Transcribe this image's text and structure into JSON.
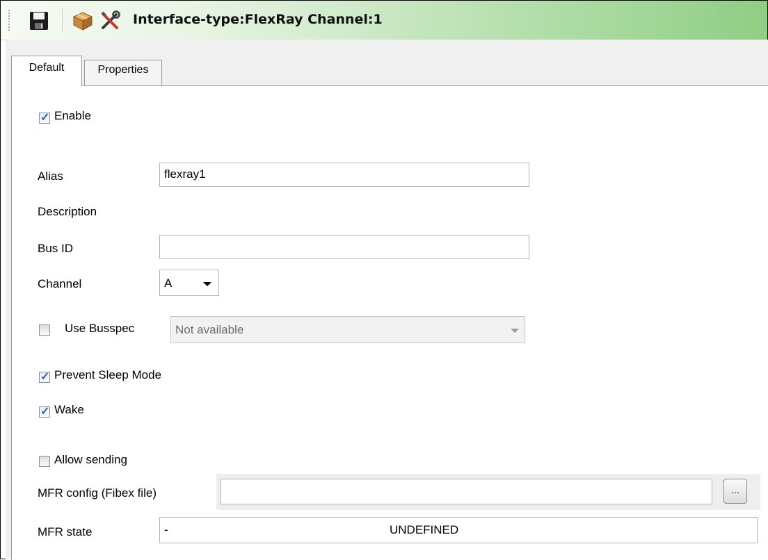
{
  "toolbar": {
    "title": "Interface-type:FlexRay Channel:1",
    "icons": [
      "save-icon",
      "package-icon",
      "tools-icon"
    ]
  },
  "tabs": [
    {
      "label": "Default",
      "selected": true
    },
    {
      "label": "Properties",
      "selected": false
    }
  ],
  "form": {
    "enable": {
      "label": "Enable",
      "checked": true
    },
    "alias": {
      "label": "Alias",
      "value": "flexray1"
    },
    "description": {
      "label": "Description"
    },
    "bus_id": {
      "label": "Bus ID",
      "value": ""
    },
    "channel": {
      "label": "Channel",
      "value": "A"
    },
    "use_busspec": {
      "label": "Use Busspec",
      "checked": false,
      "value": "Not available"
    },
    "prevent_sleep": {
      "label": "Prevent Sleep Mode",
      "checked": true
    },
    "wake": {
      "label": "Wake",
      "checked": true
    },
    "allow_sending": {
      "label": "Allow sending",
      "checked": false
    },
    "mfr_config": {
      "label": "MFR config (Fibex file)",
      "value": "",
      "browse_label": "..."
    },
    "mfr_state": {
      "label": "MFR state",
      "value_dash": "-",
      "value": "UNDEFINED"
    }
  },
  "colors": {
    "accent_green": "#8fce84",
    "check_blue": "#3a5f9e"
  }
}
